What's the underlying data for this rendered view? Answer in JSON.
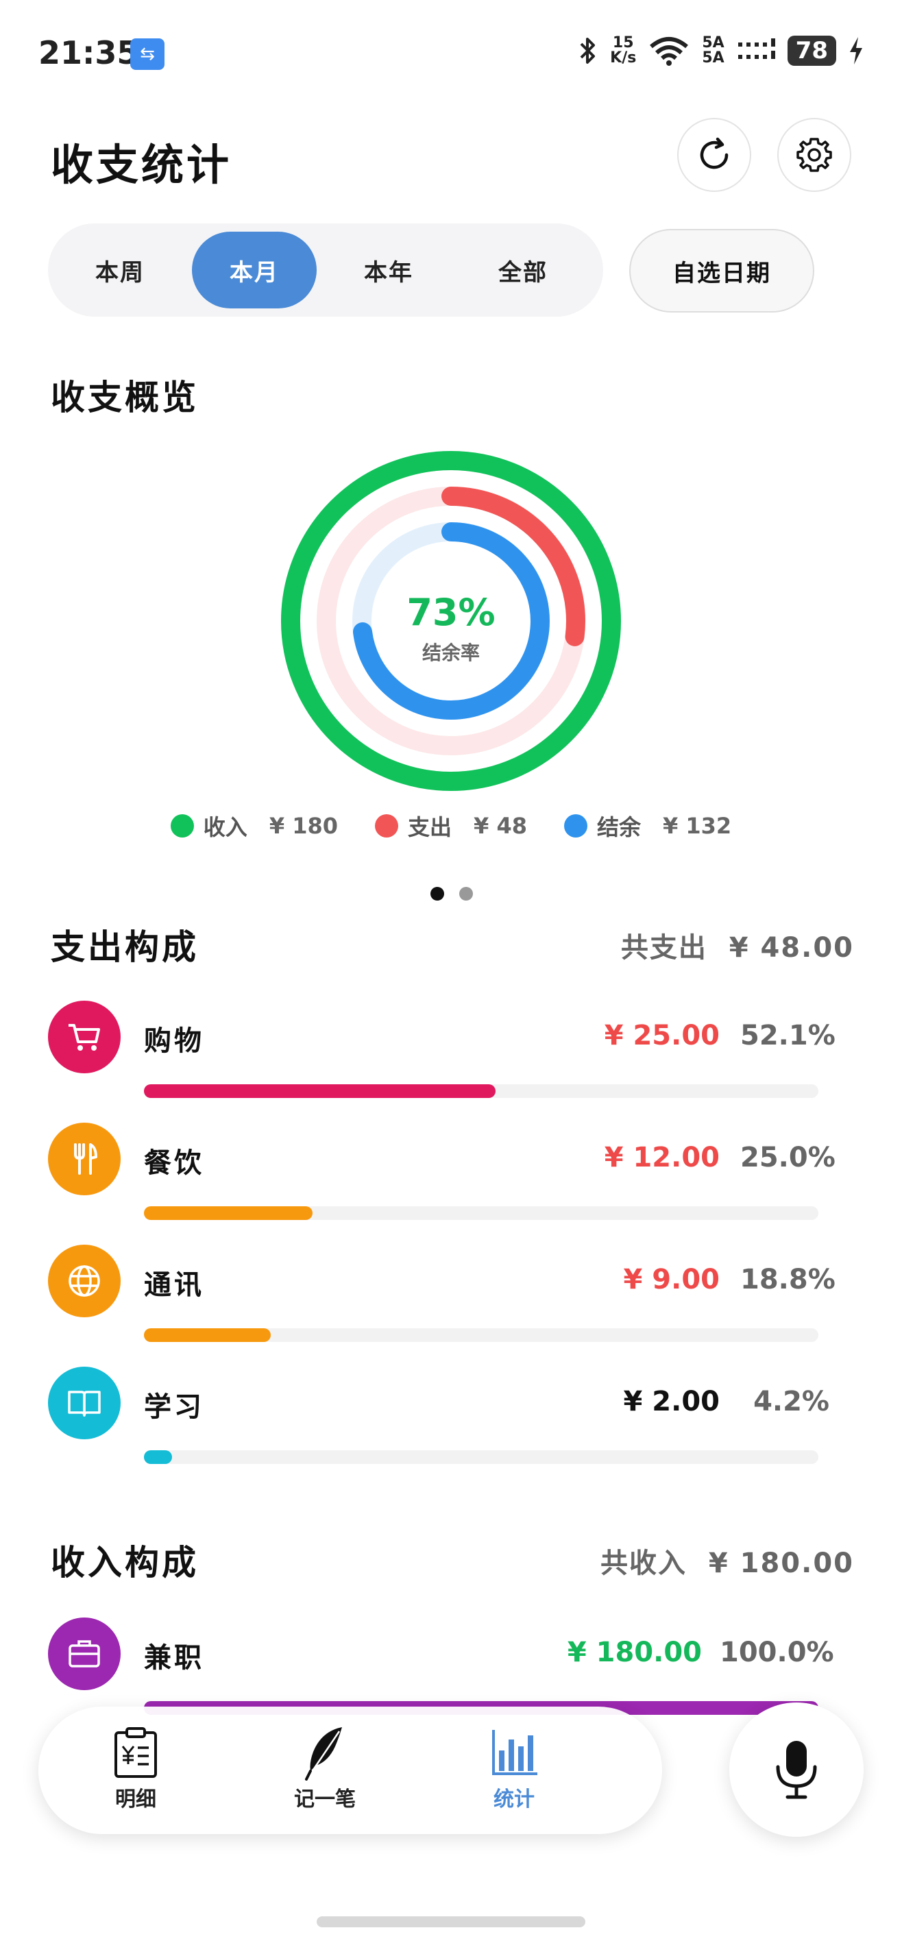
{
  "status_bar": {
    "time": "21:35",
    "net_speed_value": "15",
    "net_speed_unit": "K/s",
    "signal_label_1": "5A",
    "signal_label_2": "5A",
    "battery": "78"
  },
  "header": {
    "title": "收支统计"
  },
  "period_tabs": [
    {
      "label": "本周",
      "active": false
    },
    {
      "label": "本月",
      "active": true
    },
    {
      "label": "本年",
      "active": false
    },
    {
      "label": "全部",
      "active": false
    }
  ],
  "custom_date_label": "自选日期",
  "overview": {
    "title": "收支概览",
    "rate_value": "73%",
    "rate_label": "结余率",
    "income_level": 1.0,
    "expense_level": 0.27,
    "balance_level": 0.73,
    "legend": [
      {
        "label": "收入",
        "amount": "¥ 180",
        "color": "#11c25a"
      },
      {
        "label": "支出",
        "amount": "¥ 48",
        "color": "#f25555"
      },
      {
        "label": "结余",
        "amount": "¥ 132",
        "color": "#2f93ee"
      }
    ]
  },
  "expense": {
    "title": "支出构成",
    "total_label": "共支出",
    "total_amount": "¥ 48.00",
    "items": [
      {
        "name": "购物",
        "amount": "¥ 25.00",
        "percent": "52.1%",
        "fraction": 0.521,
        "color": "#e0195f",
        "amount_color": "#ef4a4a",
        "icon": "cart-icon"
      },
      {
        "name": "餐饮",
        "amount": "¥ 12.00",
        "percent": "25.0%",
        "fraction": 0.25,
        "color": "#f7990f",
        "amount_color": "#ef4a4a",
        "icon": "utensils-icon"
      },
      {
        "name": "通讯",
        "amount": "¥ 9.00",
        "percent": "18.8%",
        "fraction": 0.188,
        "color": "#f7990f",
        "amount_color": "#ef4a4a",
        "icon": "globe-icon"
      },
      {
        "name": "学习",
        "amount": "¥ 2.00",
        "percent": "4.2%",
        "fraction": 0.042,
        "color": "#14bcd6",
        "amount_color": "#111111",
        "icon": "book-icon"
      }
    ]
  },
  "income": {
    "title": "收入构成",
    "total_label": "共收入",
    "total_amount": "¥ 180.00",
    "items": [
      {
        "name": "兼职",
        "amount": "¥ 180.00",
        "percent": "100.0%",
        "fraction": 1.0,
        "color": "#9c27b0",
        "amount_color": "#14b85a",
        "icon": "briefcase-icon"
      }
    ]
  },
  "bottom_nav": [
    {
      "label": "明细",
      "icon": "ledger-icon",
      "active": false
    },
    {
      "label": "记一笔",
      "icon": "feather-icon",
      "active": false
    },
    {
      "label": "统计",
      "icon": "bar-chart-icon",
      "active": true
    }
  ],
  "colors": {
    "accent": "#4a8ad6",
    "income": "#11c25a",
    "expense": "#f25555",
    "balance": "#2f93ee"
  }
}
